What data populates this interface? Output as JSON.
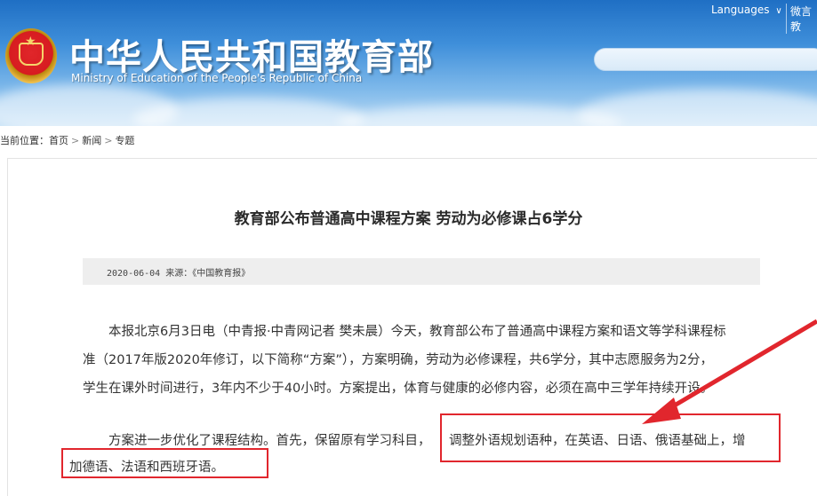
{
  "header": {
    "languages_label": "Languages",
    "languages_chevron": "∨",
    "extra_link": "微言教",
    "site_title": "中华人民共和国教育部",
    "site_subtitle": "Ministry of Education of the People's Republic of China",
    "emblem_icon": "national-emblem-icon",
    "search_placeholder": ""
  },
  "breadcrumb": {
    "prefix": "当前位置：",
    "items": [
      "首页",
      "新闻",
      "专题"
    ],
    "separator": ">"
  },
  "article": {
    "title": "教育部公布普通高中课程方案 劳动为必修课占6学分",
    "meta": "2020-06-04 来源：《中国教育报》",
    "paragraph1": {
      "line1": "本报北京6月3日电（中青报·中青网记者 樊未晨）今天，教育部公布了普通高中课程方案和语文等学科课程标",
      "line2": "准（2017年版2020年修订，以下简称“方案”），方案明确，劳动为必修课程，共6学分，其中志愿服务为2分，",
      "line3": "学生在课外时间进行，3年内不少于40小时。方案提出，体育与健康的必修内容，必须在高中三学年持续开设。"
    },
    "paragraph2": {
      "line1_a": "方案进一步优化了课程结构。首先，保留原有学习科目，",
      "line1_b": "调整外语规划语种，在英语、日语、俄语基础上，增",
      "line2": "加德语、法语和西班牙语。"
    }
  },
  "annotation": {
    "color": "#e1262d",
    "arrow_icon": "red-arrow-icon"
  }
}
